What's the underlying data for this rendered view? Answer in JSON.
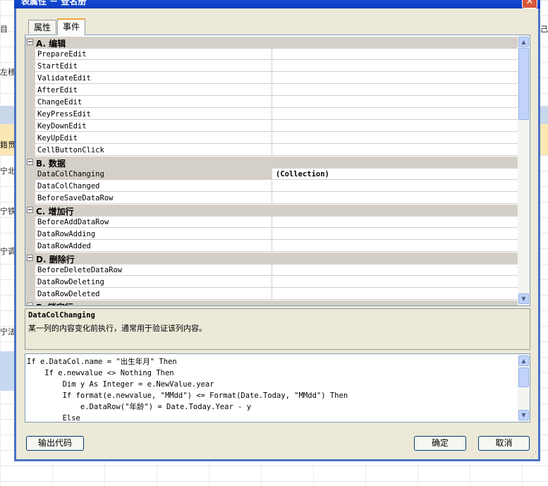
{
  "window": {
    "title": "表属性 － 登名册",
    "close_label": "✕"
  },
  "background": {
    "labels": [
      "目",
      "左移",
      "籍贯",
      "宁北",
      "宁铁",
      "宁调",
      "宁法",
      "己"
    ]
  },
  "tabs": [
    {
      "label": "属性",
      "active": false
    },
    {
      "label": "事件",
      "active": true
    }
  ],
  "property_grid": {
    "rows": [
      {
        "kind": "category",
        "label": "A. 编辑"
      },
      {
        "kind": "prop",
        "name": "PrepareEdit",
        "value": ""
      },
      {
        "kind": "prop",
        "name": "StartEdit",
        "value": ""
      },
      {
        "kind": "prop",
        "name": "ValidateEdit",
        "value": ""
      },
      {
        "kind": "prop",
        "name": "AfterEdit",
        "value": ""
      },
      {
        "kind": "prop",
        "name": "ChangeEdit",
        "value": ""
      },
      {
        "kind": "prop",
        "name": "KeyPressEdit",
        "value": ""
      },
      {
        "kind": "prop",
        "name": "KeyDownEdit",
        "value": ""
      },
      {
        "kind": "prop",
        "name": "KeyUpEdit",
        "value": ""
      },
      {
        "kind": "prop",
        "name": "CellButtonClick",
        "value": ""
      },
      {
        "kind": "category",
        "label": "B. 数据"
      },
      {
        "kind": "prop",
        "name": "DataColChanging",
        "value": "(Collection)",
        "selected": true
      },
      {
        "kind": "prop",
        "name": "DataColChanged",
        "value": ""
      },
      {
        "kind": "prop",
        "name": "BeforeSaveDataRow",
        "value": ""
      },
      {
        "kind": "category",
        "label": "C. 增加行"
      },
      {
        "kind": "prop",
        "name": "BeforeAddDataRow",
        "value": ""
      },
      {
        "kind": "prop",
        "name": "DataRowAdding",
        "value": ""
      },
      {
        "kind": "prop",
        "name": "DataRowAdded",
        "value": ""
      },
      {
        "kind": "category",
        "label": "D. 删除行"
      },
      {
        "kind": "prop",
        "name": "BeforeDeleteDataRow",
        "value": ""
      },
      {
        "kind": "prop",
        "name": "DataRowDeleting",
        "value": ""
      },
      {
        "kind": "prop",
        "name": "DataRowDeleted",
        "value": ""
      },
      {
        "kind": "category",
        "label": "E. 锁定行"
      }
    ]
  },
  "description": {
    "title": "DataColChanging",
    "text": "某一列的内容变化前执行，通常用于验证该列内容。"
  },
  "code_editor": {
    "lines": [
      "If e.DataCol.name = \"出生年月\" Then",
      "    If e.newvalue <> Nothing Then",
      "        Dim y As Integer = e.NewValue.year",
      "        If format(e.newvalue, \"MMdd\") <= Format(Date.Today, \"MMdd\") Then",
      "            e.DataRow(\"年龄\") = Date.Today.Year - y",
      "        Else"
    ]
  },
  "buttons": {
    "export_code": "输出代码",
    "ok": "确定",
    "cancel": "取消"
  }
}
